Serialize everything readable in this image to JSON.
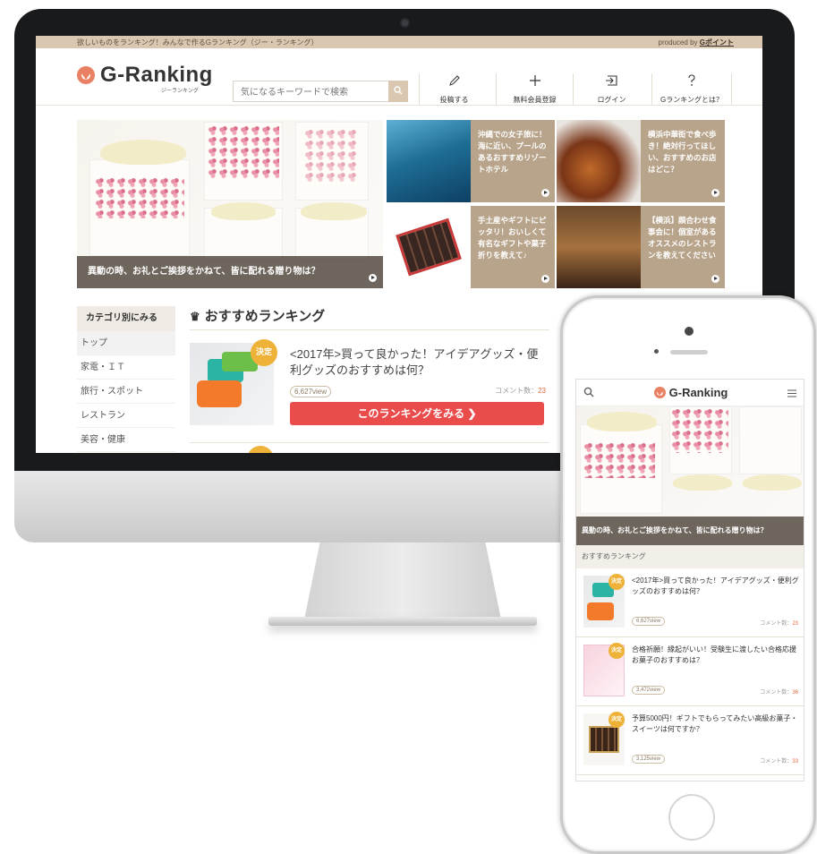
{
  "desktop": {
    "topbar": {
      "tagline": "欲しいものをランキング！みんなで作るGランキング（ジー・ランキング）",
      "produced_prefix": "produced by ",
      "produced_brand": "Gポイント"
    },
    "logo": {
      "text": "G-Ranking",
      "sub": "ジーランキング"
    },
    "search": {
      "placeholder": "気になるキーワードで検索"
    },
    "nav": [
      {
        "label": "投稿する",
        "icon": "pen-icon"
      },
      {
        "label": "無料会員登録",
        "icon": "plus-icon"
      },
      {
        "label": "ログイン",
        "icon": "login-icon"
      },
      {
        "label": "Gランキングとは？",
        "icon": "question-icon"
      }
    ],
    "hero": {
      "caption": "異動の時、お礼とご挨拶をかねて、皆に配れる贈り物は？",
      "tiles": [
        {
          "text": "沖縄での女子旅に！海に近い、プールのあるおすすめリゾートホテル"
        },
        {
          "text": "横浜中華街で食べ歩き！絶対行ってほしい、おすすめのお店はどこ？"
        },
        {
          "text": "手土産やギフトにピッタリ！おいしくて有名なギフトや菓子折りを教えて♪"
        },
        {
          "text": "【横浜】顔合わせ食事会に！個室があるオススメのレストランを教えてください"
        }
      ]
    },
    "categories": {
      "heading": "カテゴリ別にみる",
      "items": [
        "トップ",
        "家電・ＩＴ",
        "旅行・スポット",
        "レストラン",
        "美容・健康"
      ]
    },
    "ranking": {
      "heading": "おすすめランキング",
      "item": {
        "badge": "決定",
        "title": "<2017年>買って良かった！アイデアグッズ・便利グッズのおすすめは何？",
        "views": "6,627view",
        "comment_label": "コメント数：",
        "comment_count": "23",
        "cta": "このランキングをみる ❯"
      }
    }
  },
  "mobile": {
    "logo": {
      "text": "G-Ranking",
      "sub": "ジーランキング"
    },
    "hero_caption": "異動の時、お礼とご挨拶をかねて、皆に配れる贈り物は？",
    "section": "おすすめランキング",
    "items": [
      {
        "badge": "決定",
        "title": "<2017年>買って良かった！アイデアグッズ・便利グッズのおすすめは何？",
        "views": "6,627view",
        "comment_label": "コメント数：",
        "comment_count": "23"
      },
      {
        "badge": "決定",
        "title": "合格祈願！縁起がいい！受験生に渡したい合格応援お菓子のおすすめは？",
        "views": "3,472view",
        "comment_label": "コメント数：",
        "comment_count": "36"
      },
      {
        "badge": "決定",
        "title": "予算5000円！ギフトでもらってみたい高級お菓子・スイーツは何ですか？",
        "views": "3,125view",
        "comment_label": "コメント数：",
        "comment_count": "33"
      }
    ]
  }
}
